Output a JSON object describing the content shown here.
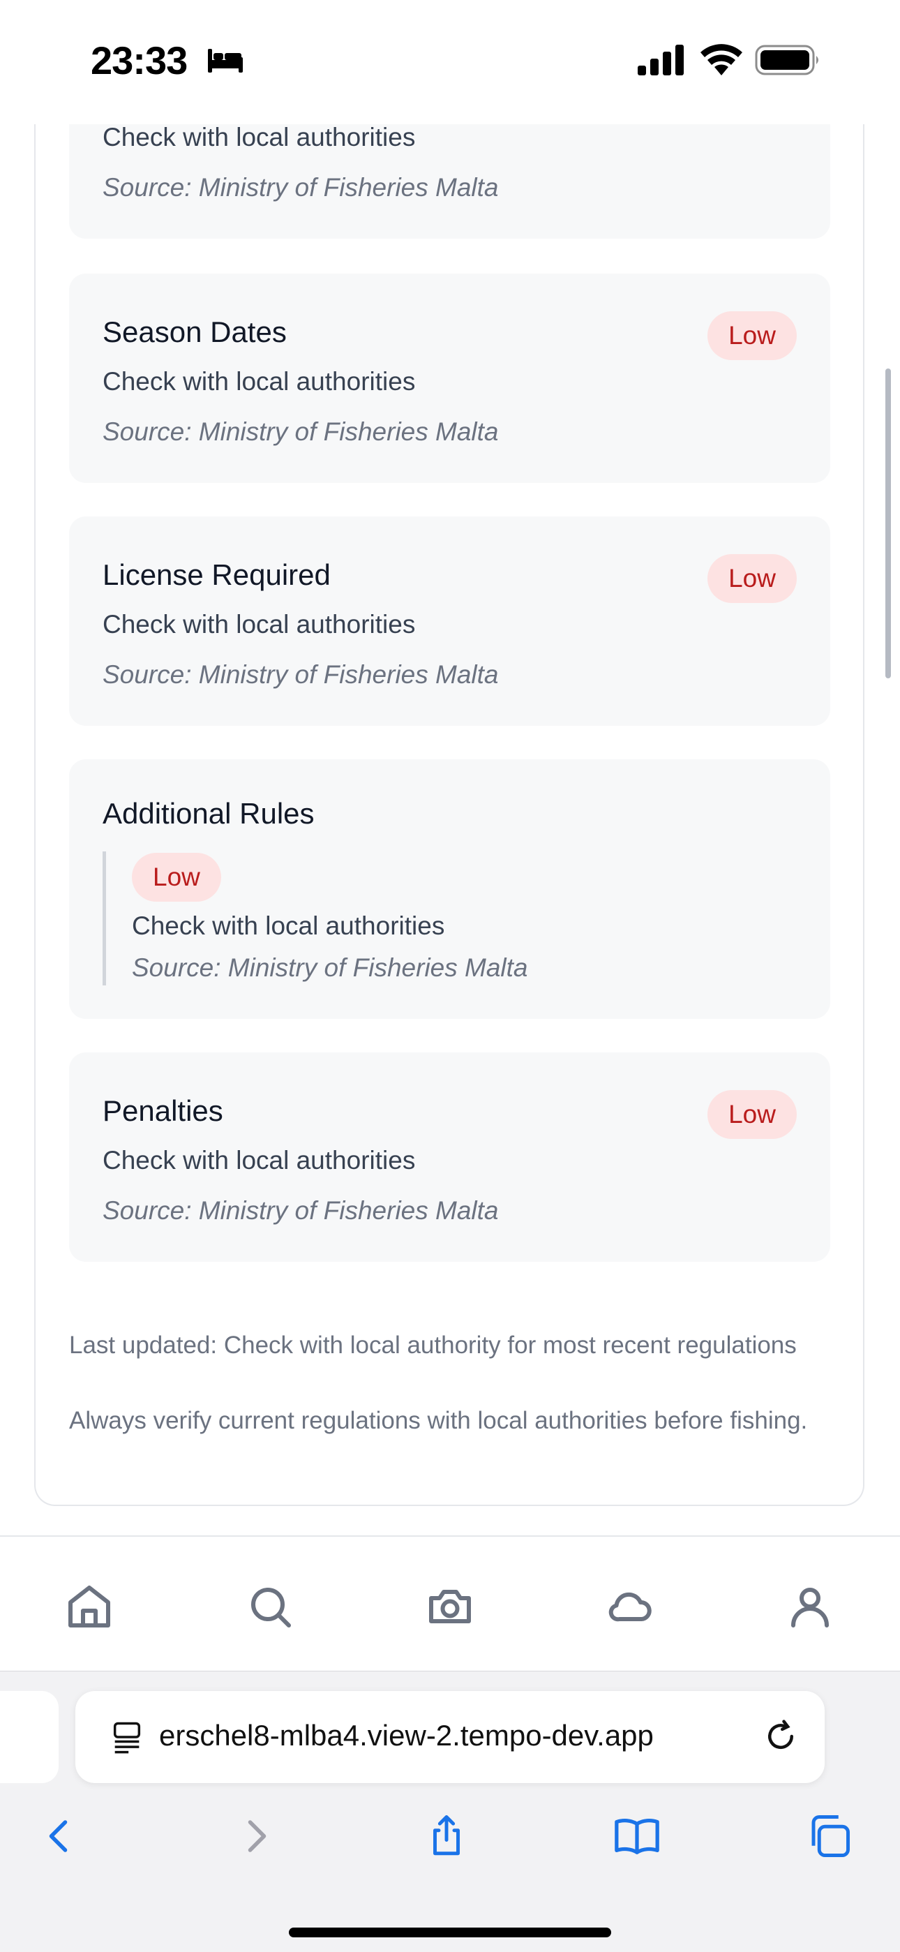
{
  "status_bar": {
    "time": "23:33",
    "icons": [
      "bed-icon",
      "cellular-signal-icon",
      "wifi-icon",
      "battery-icon"
    ]
  },
  "regulations": [
    {
      "title": "",
      "value": "Check with local authorities",
      "source": "Source: Ministry of Fisheries Malta"
    },
    {
      "title": "Season Dates",
      "badge": "Low",
      "value": "Check with local authorities",
      "source": "Source: Ministry of Fisheries Malta"
    },
    {
      "title": "License Required",
      "badge": "Low",
      "value": "Check with local authorities",
      "source": "Source: Ministry of Fisheries Malta"
    },
    {
      "title": "Additional Rules",
      "badge": "Low",
      "value": "Check with local authorities",
      "source": "Source: Ministry of Fisheries Malta"
    },
    {
      "title": "Penalties",
      "badge": "Low",
      "value": "Check with local authorities",
      "source": "Source: Ministry of Fisheries Malta"
    }
  ],
  "footer": {
    "last_updated": "Last updated: Check with local authority for most recent regulations",
    "disclaimer": "Always verify current regulations with local authorities before fishing."
  },
  "bottom_nav": [
    "home-icon",
    "search-icon",
    "camera-icon",
    "cloud-icon",
    "user-icon"
  ],
  "browser": {
    "url": "erschel8-mlba4.view-2.tempo-dev.app",
    "toolbar_icons": [
      "back-icon",
      "forward-icon",
      "share-icon",
      "bookmarks-icon",
      "tabs-icon"
    ]
  },
  "colors": {
    "badge_bg": "#fde2e2",
    "badge_text": "#b91c1c",
    "card_bg": "#f7f8f9",
    "safari_blue": "#1a73e8"
  }
}
